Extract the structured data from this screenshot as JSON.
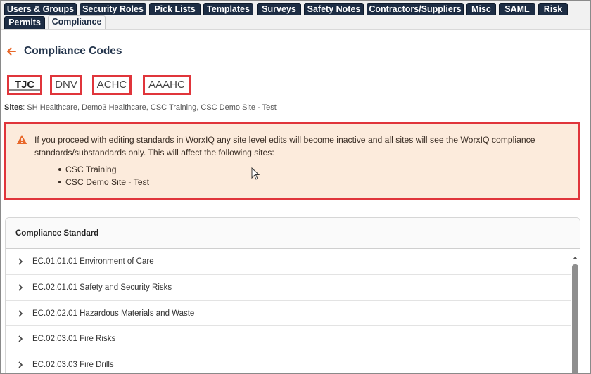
{
  "tabs": [
    {
      "label": "Users & Groups"
    },
    {
      "label": "Security Roles"
    },
    {
      "label": "Pick Lists"
    },
    {
      "label": "Templates"
    },
    {
      "label": "Surveys"
    },
    {
      "label": "Safety Notes"
    },
    {
      "label": "Contractors/Suppliers"
    },
    {
      "label": "Misc"
    },
    {
      "label": "SAML"
    },
    {
      "label": "Risk"
    },
    {
      "label": "Permits"
    },
    {
      "label": "Compliance",
      "active": true
    }
  ],
  "page": {
    "title": "Compliance Codes"
  },
  "codes": [
    {
      "label": "TJC",
      "selected": true
    },
    {
      "label": "DNV"
    },
    {
      "label": "ACHC"
    },
    {
      "label": "AAAHC"
    }
  ],
  "sites": {
    "label": "Sites",
    "value": ": SH Healthcare, Demo3 Healthcare, CSC Training, CSC Demo Site - Test"
  },
  "warning": {
    "text": "If you proceed with editing standards in WorxIQ any site level edits will become inactive and all sites will see the WorxIQ compliance standards/substandards only. This will affect the following sites:",
    "sites": [
      "CSC Training",
      "CSC Demo Site - Test"
    ]
  },
  "table": {
    "header": "Compliance Standard",
    "rows": [
      {
        "label": "EC.01.01.01 Environment of Care"
      },
      {
        "label": "EC.02.01.01 Safety and Security Risks"
      },
      {
        "label": "EC.02.02.01 Hazardous Materials and Waste"
      },
      {
        "label": "EC.02.03.01 Fire Risks"
      },
      {
        "label": "EC.02.03.03 Fire Drills"
      }
    ]
  },
  "colors": {
    "tab_bg": "#1d2d44",
    "highlight_border": "#e0353b",
    "warning_bg": "#fcebdc",
    "accent_orange": "#e8682a"
  }
}
